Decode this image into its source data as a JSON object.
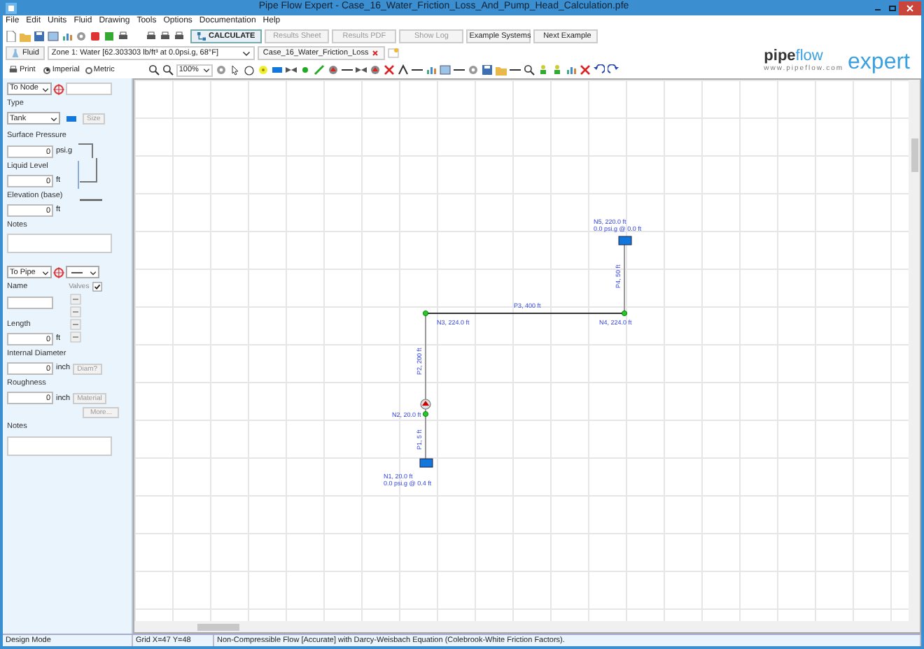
{
  "window": {
    "title": "Pipe Flow Expert - Case_16_Water_Friction_Loss_And_Pump_Head_Calculation.pfe"
  },
  "menu": [
    "File",
    "Edit",
    "Units",
    "Fluid",
    "Drawing",
    "Tools",
    "Options",
    "Documentation",
    "Help"
  ],
  "toolbar_buttons": [
    {
      "label": "CALCULATE",
      "disabled": false
    },
    {
      "label": "Results Sheet",
      "disabled": true
    },
    {
      "label": "Results PDF",
      "disabled": true
    },
    {
      "label": "Show Log",
      "disabled": true
    },
    {
      "label": "Example Systems",
      "disabled": false
    },
    {
      "label": "Next Example",
      "disabled": false
    }
  ],
  "fluid_row": {
    "fluid_button": "Fluid",
    "zone": "Zone 1: Water [62.303303 lb/ft³ at 0.0psi.g, 68°F]",
    "document_tab": "Case_16_Water_Friction_Loss"
  },
  "view_row": {
    "print_button": "Print",
    "units": [
      {
        "label": "Imperial",
        "selected": true
      },
      {
        "label": "Metric",
        "selected": false
      }
    ],
    "zoom": "100%"
  },
  "logo": {
    "brand_a": "pipe",
    "brand_b": "flow",
    "brand_c": "expert",
    "url": "www.pipeflow.com"
  },
  "node_panel": {
    "selector": "To Node",
    "type_label": "Type",
    "type_value": "Tank",
    "size_button": "Size",
    "fields": [
      {
        "label": "Surface Pressure",
        "value": "0",
        "unit": "psi.g"
      },
      {
        "label": "Liquid Level",
        "value": "0",
        "unit": "ft"
      },
      {
        "label": "Elevation (base)",
        "value": "0",
        "unit": "ft"
      }
    ],
    "notes_label": "Notes"
  },
  "pipe_panel": {
    "selector": "To Pipe",
    "name_label": "Name",
    "valves_label": "Valves",
    "valves_checked": true,
    "length": {
      "label": "Length",
      "value": "0",
      "unit": "ft"
    },
    "diameter": {
      "label": "Internal Diameter",
      "value": "0",
      "unit": "inch",
      "button": "Diam?"
    },
    "roughness": {
      "label": "Roughness",
      "value": "0",
      "unit": "inch",
      "button": "Material"
    },
    "more_button": "More...",
    "notes_label": "Notes"
  },
  "diagram": {
    "nodes": [
      {
        "label": "N5, 220.0 ft",
        "sublabel": "0.0 psi.g @ 0.0 ft",
        "kind": "tank"
      },
      {
        "label": "N3, 224.0 ft",
        "kind": "joint"
      },
      {
        "label": "N4, 224.0 ft",
        "kind": "joint"
      },
      {
        "label": "N2, 20.0 ft",
        "kind": "joint"
      },
      {
        "label": "N1, 20.0 ft",
        "sublabel": "0.0 psi.g @ 0.4 ft",
        "kind": "tank"
      }
    ],
    "pipes": [
      {
        "label": "P4, 50 ft"
      },
      {
        "label": "P3, 400 ft"
      },
      {
        "label": "P2, 200 ft"
      },
      {
        "label": "P1, 5 ft"
      }
    ]
  },
  "status_bar": [
    "Design Mode",
    "Grid X=47 Y=48",
    "Non-Compressible Flow [Accurate] with Darcy-Weisbach Equation (Colebrook-White Friction Factors)."
  ]
}
